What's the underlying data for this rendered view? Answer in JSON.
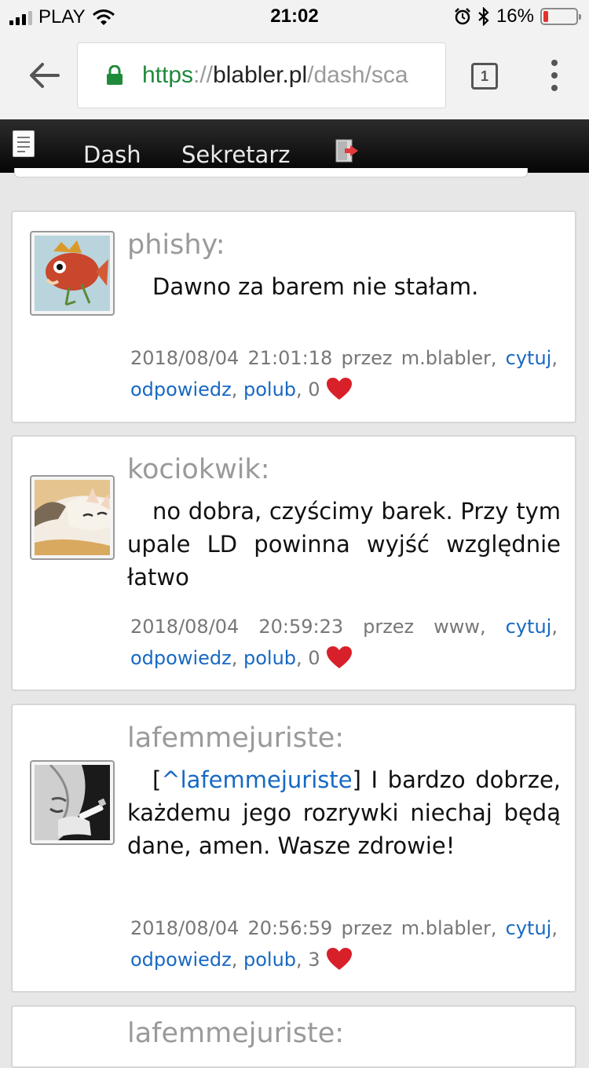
{
  "status_bar": {
    "carrier": "PLAY",
    "time": "21:02",
    "battery_percent": "16%",
    "battery_level": 0.16,
    "battery_color": "#e53030"
  },
  "browser": {
    "url_scheme": "https",
    "url_separator": "://",
    "url_domain": "blabler.pl",
    "url_path": "/dash/sca",
    "tab_count": "1",
    "icons": [
      "back-arrow-icon",
      "lock-icon",
      "tabs-icon",
      "more-vert-icon"
    ]
  },
  "site_nav": {
    "items": [
      {
        "label": "Dash"
      },
      {
        "label": "Sekretarz"
      }
    ],
    "icons": [
      "notes-icon",
      "logout-icon"
    ]
  },
  "posts": [
    {
      "username": "phishy:",
      "avatar": "fish-avatar",
      "message": "Dawno za barem nie stałam.",
      "date": "2018/08/04",
      "time": "21:01:18",
      "via_label": "przez",
      "via": "m.blabler,",
      "actions": {
        "quote": "cytuj",
        "reply": "odpowiedz",
        "like": "polub"
      },
      "like_count": "0"
    },
    {
      "username": "kociokwik:",
      "avatar": "cat-avatar",
      "message": "no dobra, czyścimy barek. Przy tym upale LD powinna wyjść względnie łatwo",
      "date": "2018/08/04",
      "time": "20:59:23",
      "via_label": "przez",
      "via": "www,",
      "actions": {
        "quote": "cytuj",
        "reply": "odpowiedz",
        "like": "polub"
      },
      "like_count": "0"
    },
    {
      "username": "lafemmejuriste:",
      "avatar": "smoker-avatar",
      "message_open_bracket": "[",
      "message_link": "^lafemmejuriste",
      "message_close_bracket": "]",
      "message": " I bardzo dobrze, każdemu jego rozrywki niechaj będą dane, amen. Wasze zdrowie!",
      "date": "2018/08/04",
      "time": "20:56:59",
      "via_label": "przez",
      "via": "m.blabler,",
      "actions": {
        "quote": "cytuj",
        "reply": "odpowiedz",
        "like": "polub"
      },
      "like_count": "3"
    },
    {
      "username": "lafemmejuriste:"
    }
  ],
  "colors": {
    "link": "#1769c3",
    "heart": "#d8202a",
    "https_green": "#1f8a3b"
  }
}
